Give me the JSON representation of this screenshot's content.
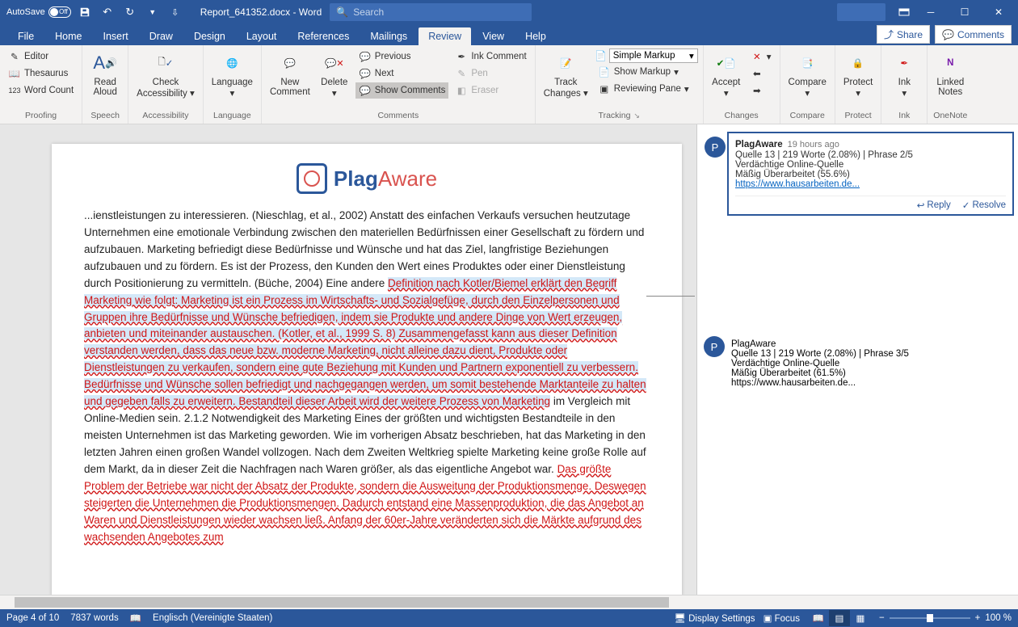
{
  "titlebar": {
    "autosave": "AutoSave",
    "autosave_state": "Off",
    "docname": "Report_641352.docx - Word",
    "search_placeholder": "Search"
  },
  "tabs": [
    "File",
    "Home",
    "Insert",
    "Draw",
    "Design",
    "Layout",
    "References",
    "Mailings",
    "Review",
    "View",
    "Help"
  ],
  "active_tab": "Review",
  "rightbtns": {
    "share": "Share",
    "comments": "Comments"
  },
  "ribbon": {
    "proofing": {
      "editor": "Editor",
      "thesaurus": "Thesaurus",
      "wordcount": "Word Count",
      "label": "Proofing"
    },
    "speech": {
      "readaloud_l1": "Read",
      "readaloud_l2": "Aloud",
      "label": "Speech"
    },
    "accessibility": {
      "check_l1": "Check",
      "check_l2": "Accessibility",
      "label": "Accessibility"
    },
    "language": {
      "btn": "Language",
      "label": "Language"
    },
    "comments": {
      "new_l1": "New",
      "new_l2": "Comment",
      "delete": "Delete",
      "previous": "Previous",
      "next": "Next",
      "show": "Show Comments",
      "ink": "Ink Comment",
      "pen": "Pen",
      "eraser": "Eraser",
      "label": "Comments"
    },
    "tracking": {
      "track_l1": "Track",
      "track_l2": "Changes",
      "markup_preset": "Simple Markup",
      "showmarkup": "Show Markup",
      "reviewpane": "Reviewing Pane",
      "label": "Tracking"
    },
    "changes": {
      "accept": "Accept",
      "label": "Changes"
    },
    "compare": {
      "btn": "Compare",
      "label": "Compare"
    },
    "protect": {
      "btn": "Protect",
      "label": "Protect"
    },
    "ink": {
      "btn": "Ink",
      "label": "Ink"
    },
    "onenote": {
      "btn_l1": "Linked",
      "btn_l2": "Notes",
      "label": "OneNote"
    }
  },
  "logo": {
    "plag": "Plag",
    "aware": "Aware"
  },
  "doc": {
    "p1": "...ienstleistungen zu interessieren. (Nieschlag, et al., 2002) Anstatt des einfachen Verkaufs versuchen heutzutage Unternehmen eine emotionale Verbindung zwischen den materiellen Bedürfnissen einer Gesellschaft zu fördern und aufzubauen. Marketing befriedigt diese Bedürfnisse und Wünsche und hat das Ziel, langfristige Beziehungen aufzubauen und zu fördern. Es ist der Prozess, den Kunden den Wert eines Produktes oder einer Dienstleistung durch Positionierung zu vermitteln. (Büche, 2004) Eine andere ",
    "hl1": "Definition nach Kotler/Biemel erklärt den Begriff Marketing wie folgt: Marketing ist ein Prozess im Wirtschafts- und Sozialgefüge, durch den Einzelpersonen und Gruppen ihre Bedürfnisse und Wünsche befriedigen, indem sie Produkte und andere Dinge von Wert erzeugen, anbieten und miteinander austauschen. (Kotler, et al., 1999 S. 8) Zusammengefasst kann aus dieser Definition verstanden werden, dass das neue bzw. moderne Marketing, nicht alleine dazu dient, Produkte oder Dienstleistungen zu verkaufen, sondern eine gute Beziehung mit Kunden und Partnern exponentiell zu verbessern. Bedürfnisse und Wünsche sollen befriedigt und nachgegangen werden, um somit bestehende Marktanteile zu halten und gegeben falls zu erweitern. Bestandteil dieser Arbeit wird der weitere Prozess von Marketing",
    "p2": " im Vergleich mit Online-Medien sein. 2.1.2 Notwendigkeit des Marketing Eines der größten und wichtigsten Bestandteile in den meisten Unternehmen ist das Marketing geworden. Wie im vorherigen Absatz beschrieben, hat das Marketing in den letzten Jahren einen großen Wandel vollzogen. Nach dem Zweiten Weltkrieg spielte Marketing keine große Rolle auf dem Markt, da in dieser Zeit die Nachfragen nach Waren größer, als das eigentliche Angebot war. ",
    "red2": "Das größte Problem der Betriebe war nicht der Absatz der Produkte, sondern die Ausweitung der Produktionsmenge. Deswegen steigerten die Unternehmen die Produktionsmengen. Dadurch entstand eine Massenproduktion, die das Angebot an Waren und Dienstleistungen wieder wachsen ließ. Anfang der 60er-Jahre veränderten sich die Märkte aufgrund des wachsenden Angebotes zum"
  },
  "comments_data": [
    {
      "author": "PlagAware",
      "time": "19 hours ago",
      "l1": "Quelle 13 | 219 Worte (2.08%) | Phrase 2/5",
      "l2": "Verdächtige Online-Quelle",
      "l3": "Mäßig Überarbeitet (55.6%)",
      "link": "https://www.hausarbeiten.de...",
      "reply": "Reply",
      "resolve": "Resolve"
    },
    {
      "author": "PlagAware",
      "l1": "Quelle 13 | 219 Worte (2.08%) | Phrase 3/5",
      "l2": "Verdächtige Online-Quelle",
      "l3": "Mäßig Überarbeitet (61.5%)",
      "link": "https://www.hausarbeiten.de..."
    }
  ],
  "statusbar": {
    "page": "Page 4 of 10",
    "words": "7837 words",
    "lang": "Englisch (Vereinigte Staaten)",
    "display": "Display Settings",
    "focus": "Focus",
    "zoom": "100 %"
  }
}
